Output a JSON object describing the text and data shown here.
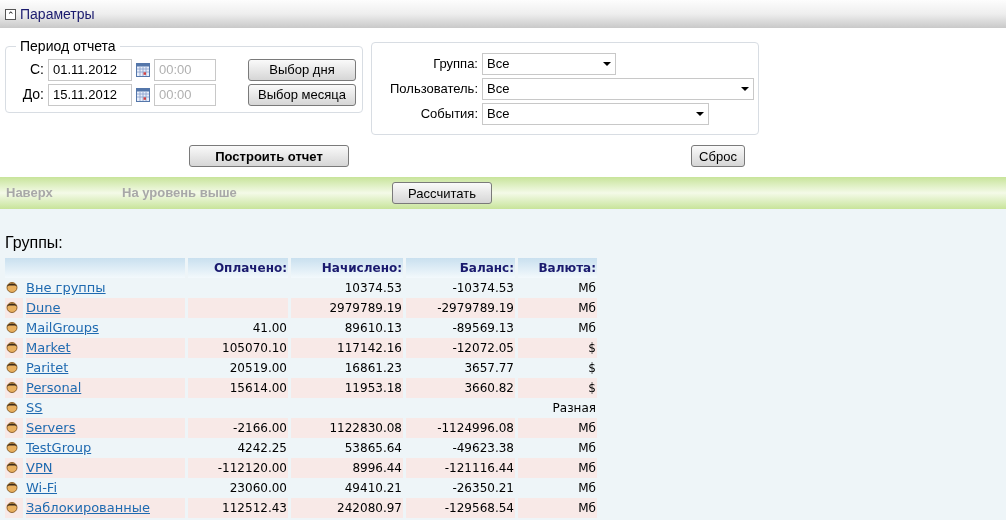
{
  "header": {
    "title": "Параметры",
    "collapse_icon": "⌃"
  },
  "period": {
    "legend": "Период отчета",
    "from": {
      "label": "С:",
      "date": "01.11.2012",
      "time_placeholder": "00:00"
    },
    "to": {
      "label": "До:",
      "date": "15.11.2012",
      "time_placeholder": "00:00"
    },
    "buttons": [
      "Выбор дня",
      "Выбор месяца"
    ]
  },
  "filters": [
    {
      "label": "Группа:",
      "value": "Все"
    },
    {
      "label": "Пользователь:",
      "value": "Все"
    },
    {
      "label": "События:",
      "value": "Все"
    }
  ],
  "build_button": "Построить отчет",
  "reset_button": "Сброс",
  "nav": {
    "links": [
      {
        "label": "Наверх",
        "disabled": true
      },
      {
        "label": "На уровень выше",
        "disabled": true
      }
    ],
    "button": "Рассчитать"
  },
  "table": {
    "title": "Группы:",
    "columns": [
      "Оплачено:",
      "Начислено:",
      "Баланс:",
      "Валюта:"
    ],
    "rows": [
      {
        "name": "Вне группы",
        "paid": "",
        "charged": "10374.53",
        "balance": "-10374.53",
        "currency": "Мб"
      },
      {
        "name": "Dune",
        "paid": "",
        "charged": "2979789.19",
        "balance": "-2979789.19",
        "currency": "Мб"
      },
      {
        "name": "MailGroups",
        "paid": "41.00",
        "charged": "89610.13",
        "balance": "-89569.13",
        "currency": "Мб"
      },
      {
        "name": "Market",
        "paid": "105070.10",
        "charged": "117142.16",
        "balance": "-12072.05",
        "currency": "$"
      },
      {
        "name": "Paritet",
        "paid": "20519.00",
        "charged": "16861.23",
        "balance": "3657.77",
        "currency": "$"
      },
      {
        "name": "Personal",
        "paid": "15614.00",
        "charged": "11953.18",
        "balance": "3660.82",
        "currency": "$"
      },
      {
        "name": "SS",
        "paid": "",
        "charged": "",
        "balance": "",
        "currency": "Разная"
      },
      {
        "name": "Servers",
        "paid": "-2166.00",
        "charged": "1122830.08",
        "balance": "-1124996.08",
        "currency": "Мб"
      },
      {
        "name": "TestGroup",
        "paid": "4242.25",
        "charged": "53865.64",
        "balance": "-49623.38",
        "currency": "Мб"
      },
      {
        "name": "VPN",
        "paid": "-112120.00",
        "charged": "8996.44",
        "balance": "-121116.44",
        "currency": "Мб"
      },
      {
        "name": "Wi-Fi",
        "paid": "23060.00",
        "charged": "49410.21",
        "balance": "-26350.21",
        "currency": "Мб"
      },
      {
        "name": "Заблокированные",
        "paid": "112512.43",
        "charged": "242080.97",
        "balance": "-129568.54",
        "currency": "Мб"
      }
    ]
  }
}
